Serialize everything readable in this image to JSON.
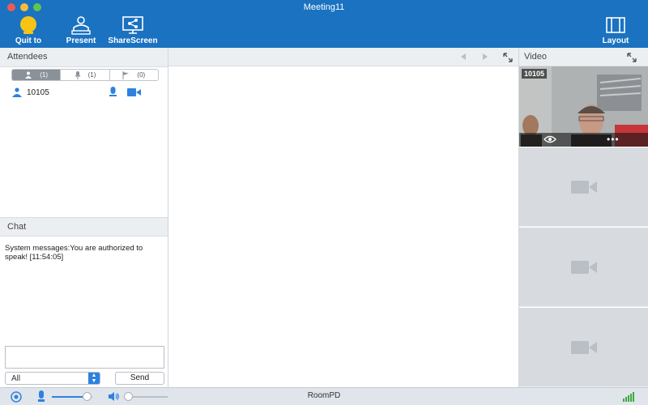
{
  "window": {
    "title": "Meeting11"
  },
  "toolbar": {
    "quit_label": "Quit to",
    "present_label": "Present",
    "share_label": "ShareScreen",
    "layout_label": "Layout"
  },
  "attendees": {
    "header": "Attendees",
    "tabs": [
      {
        "icon": "person-icon",
        "count": "(1)"
      },
      {
        "icon": "microphone-icon",
        "count": "(1)"
      },
      {
        "icon": "flag-icon",
        "count": "(0)"
      }
    ],
    "list": [
      {
        "name": "10105"
      }
    ]
  },
  "chat": {
    "header": "Chat",
    "message": "System messages:You are authorized to speak! [11:54:05]",
    "recipient": "All",
    "send_label": "Send",
    "input_value": ""
  },
  "video": {
    "header": "Video",
    "tiles": [
      {
        "label": "10105",
        "live": true
      }
    ]
  },
  "status": {
    "room": "RoomPD",
    "mic_level": 0.85,
    "speaker_level": 0.0
  },
  "colors": {
    "toolbar": "#1a72c0",
    "accent": "#2d82e0",
    "quit_icon": "#f5c416"
  }
}
